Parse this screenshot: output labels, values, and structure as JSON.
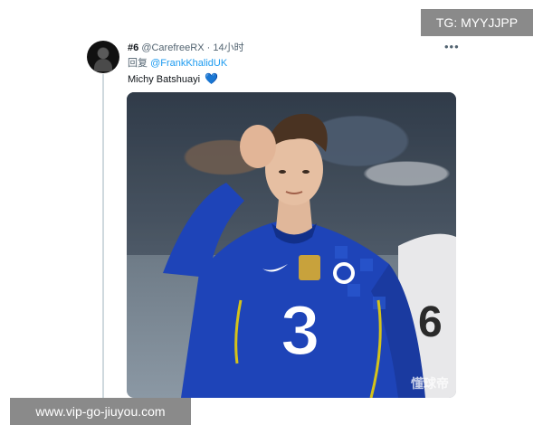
{
  "tweet": {
    "rank": "#6",
    "handle": "@CarefreeRX",
    "separator": "·",
    "time": "14小时",
    "more_icon": "more-horizontal-icon",
    "reply_prefix": "回复",
    "reply_to": "@FrankKhalidUK",
    "text": "Michy Batshuayi",
    "emoji": "💙"
  },
  "photo": {
    "watermark": "懂球帝"
  },
  "overlays": {
    "tg_label": "TG: MYYJJPP",
    "url_label": "www.vip-go-jiuyou.com"
  },
  "colors": {
    "link": "#1d9bf0",
    "muted": "#536471",
    "overlay_bg": "#8a8a8a",
    "jersey": "#1e44b8"
  }
}
